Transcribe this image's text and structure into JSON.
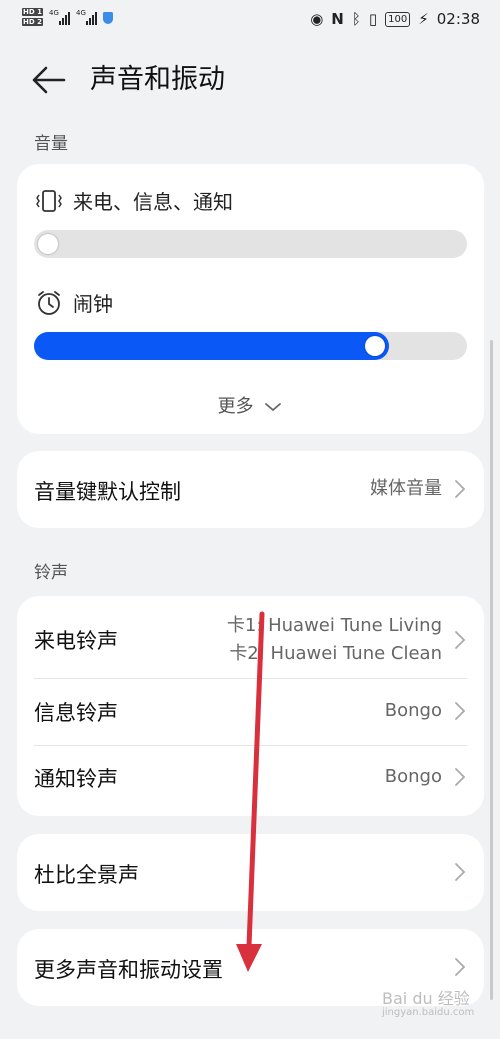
{
  "statusbar": {
    "hd1": "HD 1",
    "hd2": "HD 2",
    "net1": "4G",
    "net2": "4G",
    "battery": "100",
    "time": "02:38"
  },
  "header": {
    "title": "声音和振动"
  },
  "volume": {
    "section_label": "音量",
    "items": [
      {
        "label": "来电、信息、通知",
        "icon": "vibrate-icon",
        "level": 0.0
      },
      {
        "label": "闹钟",
        "icon": "alarm-clock-icon",
        "level": 0.82
      }
    ],
    "more_label": "更多"
  },
  "volume_key": {
    "label": "音量键默认控制",
    "value": "媒体音量"
  },
  "ringtone": {
    "section_label": "铃声",
    "call": {
      "label": "来电铃声",
      "value_line1": "卡1: Huawei Tune Living",
      "value_line2": "卡2: Huawei Tune Clean"
    },
    "message": {
      "label": "信息铃声",
      "value": "Bongo"
    },
    "notification": {
      "label": "通知铃声",
      "value": "Bongo"
    }
  },
  "dolby": {
    "label": "杜比全景声"
  },
  "more_settings": {
    "label": "更多声音和振动设置"
  },
  "colors": {
    "accent": "#0a59f7",
    "annotation_arrow": "#d9303e",
    "background": "#f1f2f4"
  },
  "watermark": {
    "line1": "Bai du 经验",
    "line2": "jingyan.baidu.com"
  }
}
